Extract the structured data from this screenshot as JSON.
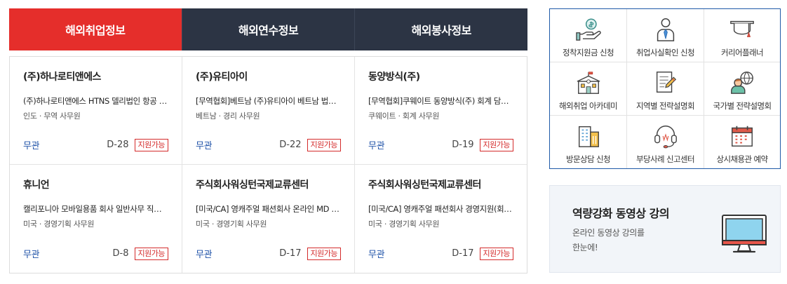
{
  "tabs": [
    {
      "label": "해외취업정보",
      "active": true
    },
    {
      "label": "해외연수정보",
      "active": false
    },
    {
      "label": "해외봉사정보",
      "active": false
    }
  ],
  "jobs": [
    {
      "company": "(주)하나로티앤에스",
      "title": "(주)하나로티앤에스 HTNS 델리법인 항공 수출입 담당 채용",
      "meta": "인도 · 무역 사무원",
      "education": "무관",
      "dday": "D-28",
      "badge": "지원가능"
    },
    {
      "company": "(주)유티아이",
      "title": "[무역협회]베트남 (주)유티아이 베트남 법인 경리 채용",
      "meta": "베트남 · 경리 사무원",
      "education": "무관",
      "dday": "D-22",
      "badge": "지원가능"
    },
    {
      "company": "동양방식(주)",
      "title": "[무역협회]쿠웨이트 동양방식(주) 회계 담당 채용",
      "meta": "쿠웨이트 · 회계 사무원",
      "education": "무관",
      "dday": "D-19",
      "badge": "지원가능"
    },
    {
      "company": "휴니언",
      "title": "캘리포니아 모바일용품 회사 일반사무 직원 채용",
      "meta": "미국 · 경영기획 사무원",
      "education": "무관",
      "dday": "D-8",
      "badge": "지원가능"
    },
    {
      "company": "주식회사워싱턴국제교류센터",
      "title": "[미국/CA] 영캐주얼 패션회사 온라인 MD 채용",
      "meta": "미국 · 경영기획 사무원",
      "education": "무관",
      "dday": "D-17",
      "badge": "지원가능"
    },
    {
      "company": "주식회사워싱턴국제교류센터",
      "title": "[미국/CA] 영캐주얼 패션회사 경영지원(회계) 채용",
      "meta": "미국 · 경영기획 사무원",
      "education": "무관",
      "dday": "D-17",
      "badge": "지원가능"
    }
  ],
  "quick_menu": [
    {
      "label": "정착지원금 신청",
      "icon": "money-hand-icon"
    },
    {
      "label": "취업사실확인 신청",
      "icon": "person-tie-icon"
    },
    {
      "label": "커리어플래너",
      "icon": "graduation-cap-icon"
    },
    {
      "label": "해외취업 아카데미",
      "icon": "school-building-icon"
    },
    {
      "label": "지역별 전략설명회",
      "icon": "document-pen-icon"
    },
    {
      "label": "국가별 전략설명회",
      "icon": "person-globe-icon"
    },
    {
      "label": "방문상담 신청",
      "icon": "office-building-icon"
    },
    {
      "label": "부당사례 신고센터",
      "icon": "headset-icon"
    },
    {
      "label": "상시채용관 예약",
      "icon": "calendar-icon"
    }
  ],
  "lecture": {
    "title": "역량강화 동영상 강의",
    "desc_line1": "온라인 동영상 강의를",
    "desc_line2": "한눈에!",
    "icon": "monitor-icon"
  },
  "colors": {
    "accent_red": "#e52e2b",
    "tab_dark": "#2c3444",
    "link_blue": "#1f52a8",
    "quick_border": "#1f5aa8"
  }
}
